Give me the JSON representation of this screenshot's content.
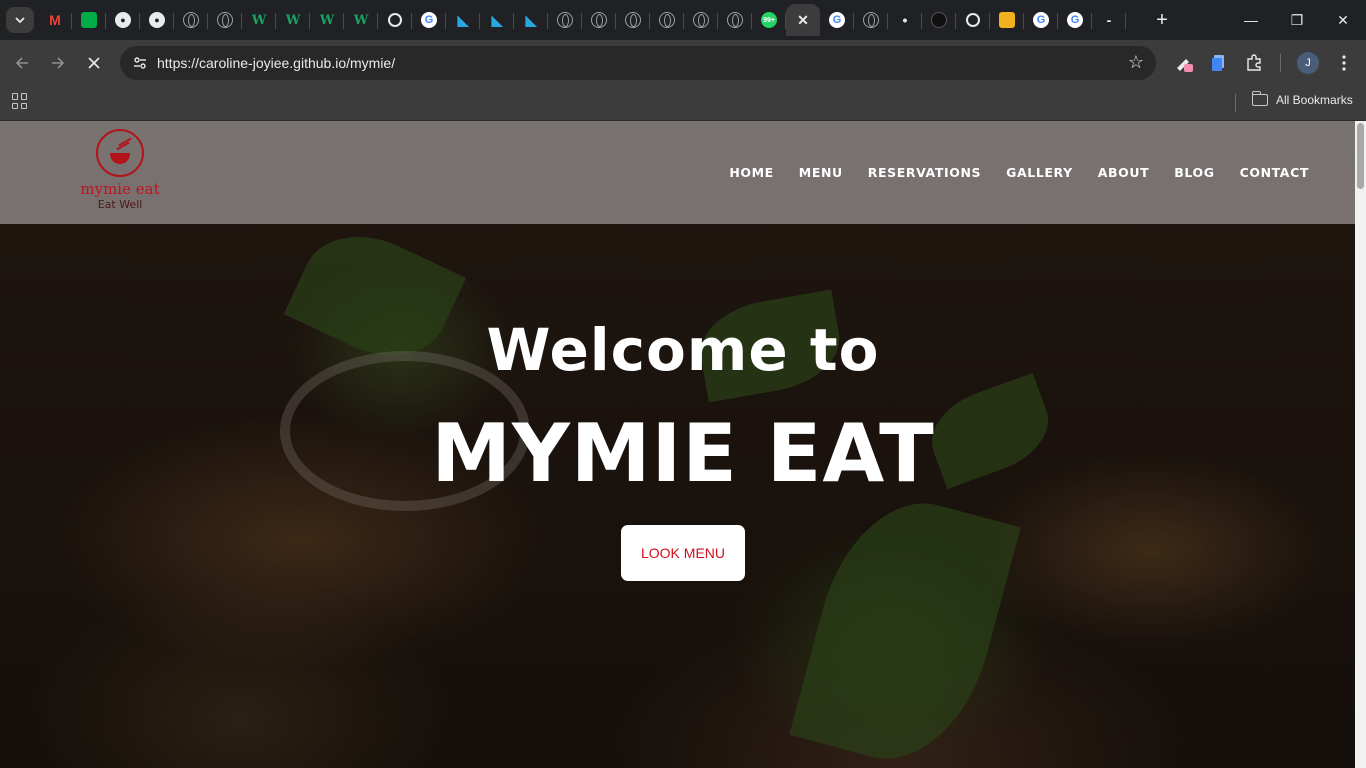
{
  "browser": {
    "tabs": [
      {
        "icon": "gmail-icon",
        "glyph": "M",
        "kind": "m"
      },
      {
        "icon": "meet-icon",
        "glyph": "",
        "kind": "meet"
      },
      {
        "icon": "github-icon",
        "glyph": "●",
        "kind": "gh"
      },
      {
        "icon": "github-icon",
        "glyph": "●",
        "kind": "gh"
      },
      {
        "icon": "globe-icon",
        "glyph": "",
        "kind": "globe"
      },
      {
        "icon": "globe-icon",
        "glyph": "",
        "kind": "globe"
      },
      {
        "icon": "w-site-icon",
        "glyph": "W",
        "kind": "w"
      },
      {
        "icon": "w-site-icon",
        "glyph": "W",
        "kind": "w"
      },
      {
        "icon": "w-site-icon",
        "glyph": "W",
        "kind": "w"
      },
      {
        "icon": "w-site-icon",
        "glyph": "W",
        "kind": "w"
      },
      {
        "icon": "chatgpt-icon",
        "glyph": "",
        "kind": "ai"
      },
      {
        "icon": "google-icon",
        "glyph": "G",
        "kind": "g"
      },
      {
        "icon": "bolt-icon",
        "glyph": "◣",
        "kind": "bolt"
      },
      {
        "icon": "bolt-icon",
        "glyph": "◣",
        "kind": "bolt"
      },
      {
        "icon": "bolt-icon",
        "glyph": "◣",
        "kind": "bolt"
      },
      {
        "icon": "globe-icon",
        "glyph": "",
        "kind": "globe"
      },
      {
        "icon": "globe-icon",
        "glyph": "",
        "kind": "globe"
      },
      {
        "icon": "globe-icon",
        "glyph": "",
        "kind": "globe"
      },
      {
        "icon": "globe-icon",
        "glyph": "",
        "kind": "globe"
      },
      {
        "icon": "globe-icon",
        "glyph": "",
        "kind": "globe"
      },
      {
        "icon": "globe-icon",
        "glyph": "",
        "kind": "globe"
      },
      {
        "icon": "whatsapp-icon",
        "glyph": "99+",
        "kind": "wa"
      },
      {
        "icon": "close-icon",
        "glyph": "✕",
        "kind": "close",
        "active": true
      },
      {
        "icon": "google-icon",
        "glyph": "G",
        "kind": "g"
      },
      {
        "icon": "globe-icon",
        "glyph": "",
        "kind": "globe"
      },
      {
        "icon": "dot-icon",
        "glyph": "•",
        "kind": "close"
      },
      {
        "icon": "bug-icon",
        "glyph": "",
        "kind": "dark"
      },
      {
        "icon": "chatgpt-icon",
        "glyph": "",
        "kind": "ai"
      },
      {
        "icon": "scholar-icon",
        "glyph": "",
        "kind": "yel"
      },
      {
        "icon": "google-icon",
        "glyph": "G",
        "kind": "g"
      },
      {
        "icon": "google-icon",
        "glyph": "G",
        "kind": "g"
      },
      {
        "icon": "blank-icon",
        "glyph": "-",
        "kind": "close"
      }
    ],
    "new_tab_label": "+",
    "minimize_label": "—",
    "restore_label": "❐",
    "close_label": "✕",
    "url": "https://caroline-joyiee.github.io/mymie/",
    "profile_initial": "J",
    "all_bookmarks_label": "All Bookmarks"
  },
  "site": {
    "logo": {
      "name": "mymie  eat",
      "tagline": "Eat Well"
    },
    "nav": [
      "HOME",
      "MENU",
      "RESERVATIONS",
      "GALLERY",
      "ABOUT",
      "BLOG",
      "CONTACT"
    ],
    "hero": {
      "welcome": "Welcome to",
      "brand": "MYMIE EAT",
      "cta_label": "LOOK MENU"
    }
  },
  "colors": {
    "brand_red": "#c1121f",
    "cta_text": "#d10f1f",
    "header_bg": "#8c8686"
  }
}
